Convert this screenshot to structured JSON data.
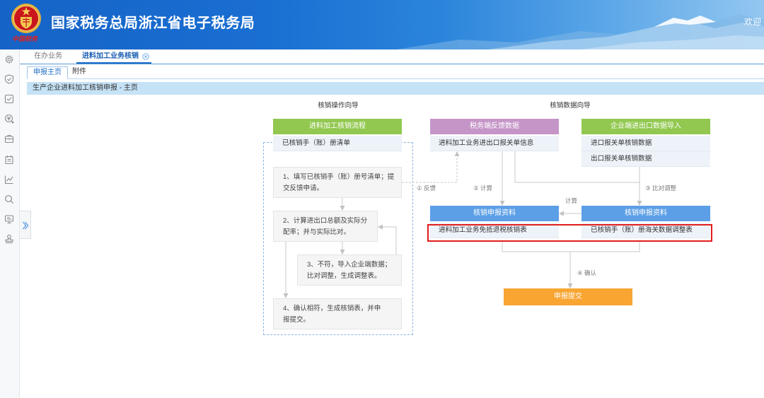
{
  "header": {
    "title": "国家税务总局浙江省电子税务局",
    "emblem_caption": "中国税务",
    "welcome": "欢迎"
  },
  "sidebar": {
    "icons": [
      "settings-icon",
      "shield-check-icon",
      "checkbox-icon",
      "refund-icon",
      "briefcase-icon",
      "calendar-icon",
      "chart-icon",
      "search-icon",
      "monitor-icon",
      "stamp-icon"
    ],
    "toggle_icon": "expand-sidebar-icon"
  },
  "tabs": [
    {
      "label": "在办业务",
      "active": false
    },
    {
      "label": "进料加工业务核销",
      "active": true,
      "close_icon": "close-circle-icon"
    }
  ],
  "subtabs": [
    {
      "label": "申报主页",
      "active": true
    },
    {
      "label": "附件",
      "active": false
    }
  ],
  "page_title": "生产企业进料加工核销申报 - 主页",
  "guide": {
    "operation_title": "核销操作向导",
    "data_title": "核销数据向导",
    "process": {
      "header": "进料加工核销流程",
      "items": [
        "已核销手（账）册清单"
      ]
    },
    "steps": [
      {
        "lines": [
          "1、填写已核销手（账）册号清单；提",
          "交反馈申请。"
        ]
      },
      {
        "lines": [
          "2、计算进出口总额及实际分",
          "配率；并与实际比对。"
        ]
      },
      {
        "lines": [
          "3、不符，导入企业端数据；",
          "比对调整，生成调整表。"
        ]
      },
      {
        "lines": [
          "4、确认相符，生成核销表，并申",
          "报提交。"
        ]
      }
    ],
    "tax_feedback": {
      "header": "税务端反馈数据",
      "items": [
        "进料加工业务进出口报关单信息"
      ]
    },
    "enterprise_import": {
      "header": "企业端进出口数据导入",
      "items": [
        "进口报关单核销数据",
        "出口报关单核销数据"
      ]
    },
    "declare_tax": {
      "header": "核销申报资料",
      "items": [
        "进料加工业务免抵退税核销表"
      ]
    },
    "declare_enterprise": {
      "header": "核销申报资料",
      "items": [
        "已核销手（账）册海关数据调整表"
      ]
    },
    "submit_label": "申报提交",
    "flow_labels": {
      "feedback": "① 反馈",
      "calculate": "② 计算",
      "compare_adjust": "③ 比对调整",
      "calculate_cross": "计算",
      "confirm": "④ 确认"
    }
  },
  "colors": {
    "brand": "#1a6dc8",
    "green": "#92c850",
    "purple": "#c595c8",
    "blue": "#5d9fe6",
    "orange": "#f8a532",
    "highlight_red": "#e21d1d"
  }
}
